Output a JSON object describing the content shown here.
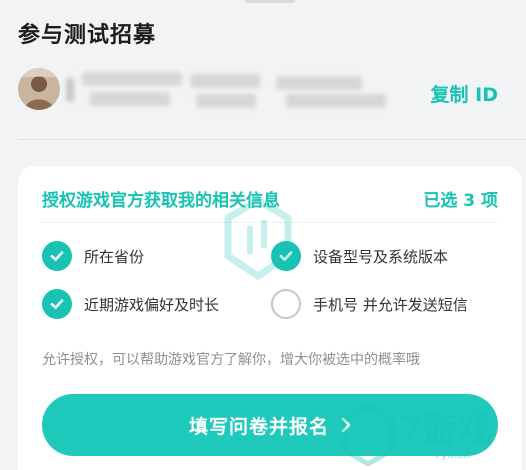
{
  "header": {
    "title": "参与测试招募"
  },
  "user": {
    "copy_id_label": "复制 ID"
  },
  "card": {
    "title": "授权游戏官方获取我的相关信息",
    "selected_count": "已选 3 项",
    "options": [
      {
        "label": "所在省份",
        "checked": true
      },
      {
        "label": "设备型号及系统版本",
        "checked": true
      },
      {
        "label": "近期游戏偏好及时长",
        "checked": true
      },
      {
        "label": "手机号 并允许发送短信",
        "checked": false
      }
    ],
    "hint": "允许授权，可以帮助游戏官方了解你，增大你被选中的概率哦",
    "submit_label": "填写问卷并报名"
  },
  "watermark": {
    "text": "7游戏",
    "sub": "7yx.cn"
  },
  "colors": {
    "accent": "#17c3b2",
    "button": "#1fcabc",
    "unchecked": "#c4c6ca"
  }
}
